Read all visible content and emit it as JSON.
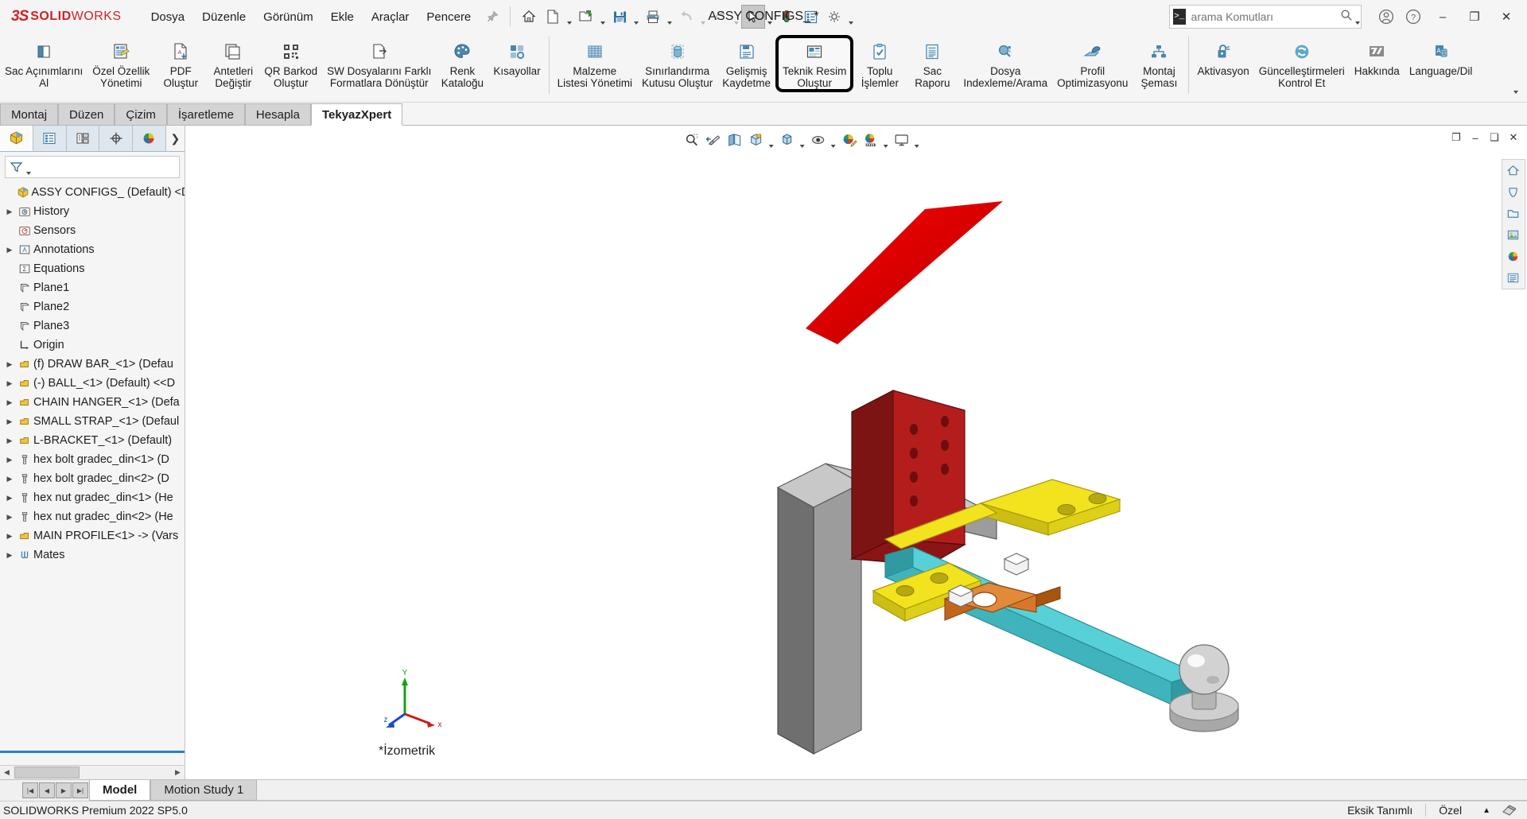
{
  "app": {
    "brand_ds": "3S",
    "brand_bold": "SOLID",
    "brand_light": "WORKS",
    "document_title": "ASSY CONFIGS_ *",
    "accent_red": "#d42027",
    "accent_blue": "#2b7fc4"
  },
  "menubar": {
    "items": [
      {
        "label": "Dosya"
      },
      {
        "label": "Düzenle"
      },
      {
        "label": "Görünüm"
      },
      {
        "label": "Ekle"
      },
      {
        "label": "Araçlar"
      },
      {
        "label": "Pencere"
      }
    ],
    "pin_icon": "pin-icon"
  },
  "quick_access": {
    "buttons": [
      {
        "name": "home-icon",
        "has_caret": false,
        "selected": false,
        "disabled": false
      },
      {
        "name": "new-document-icon",
        "has_caret": true,
        "selected": false,
        "disabled": false
      },
      {
        "name": "open-folder-icon",
        "has_caret": true,
        "selected": false,
        "disabled": false
      },
      {
        "name": "save-icon",
        "has_caret": true,
        "selected": false,
        "disabled": false
      },
      {
        "name": "print-icon",
        "has_caret": true,
        "selected": false,
        "disabled": false
      },
      {
        "name": "undo-icon",
        "has_caret": true,
        "selected": false,
        "disabled": true
      },
      {
        "name": "redo-icon",
        "has_caret": true,
        "selected": false,
        "disabled": true
      },
      {
        "name": "select-cursor-icon",
        "has_caret": true,
        "selected": true,
        "disabled": false
      },
      {
        "name": "rebuild-traffic-light-icon",
        "has_caret": false,
        "selected": false,
        "disabled": false
      },
      {
        "name": "file-properties-icon",
        "has_caret": false,
        "selected": false,
        "disabled": false
      },
      {
        "name": "options-gear-icon",
        "has_caret": true,
        "selected": false,
        "disabled": false
      }
    ]
  },
  "search": {
    "placeholder": "arama Komutları",
    "value": "",
    "prompt_glyph": ">_"
  },
  "window_controls": {
    "account": "account-icon",
    "help": "help-icon",
    "minimize": "–",
    "restore": "❐",
    "close": "✕"
  },
  "ribbon": {
    "groups": [
      {
        "name": "tekyazxpert-tools",
        "buttons": [
          {
            "label": "Sac Açınımlarını\nAl",
            "icon": "sheet-metal-flatten-icon",
            "highlight": false
          },
          {
            "label": "Özel Özellik\nYönetimi",
            "icon": "custom-property-icon",
            "highlight": false
          },
          {
            "label": "PDF\nOluştur",
            "icon": "pdf-create-icon",
            "highlight": false
          },
          {
            "label": "Antetleri\nDeğiştir",
            "icon": "title-block-change-icon",
            "highlight": false
          },
          {
            "label": "QR Barkod\nOluştur",
            "icon": "qr-barcode-icon",
            "highlight": false
          },
          {
            "label": "SW Dosyalarını Farklı\nFormatlara Dönüştür",
            "icon": "export-format-icon",
            "highlight": false
          },
          {
            "label": "Renk\nKataloğu",
            "icon": "color-palette-icon",
            "highlight": false
          },
          {
            "label": "Kısayollar",
            "icon": "shortcuts-icon",
            "highlight": false
          }
        ]
      },
      {
        "name": "management-tools",
        "buttons": [
          {
            "label": "Malzeme\nListesi Yönetimi",
            "icon": "bom-table-icon",
            "highlight": false
          },
          {
            "label": "Sınırlandırma\nKutusu Oluştur",
            "icon": "bounding-box-icon",
            "highlight": false
          },
          {
            "label": "Gelişmiş\nKaydetme",
            "icon": "advanced-save-icon",
            "highlight": false
          },
          {
            "label": "Teknik Resim\nOluştur",
            "icon": "create-drawing-icon",
            "highlight": true
          },
          {
            "label": "Toplu\nİşlemler",
            "icon": "batch-operations-icon",
            "highlight": false
          },
          {
            "label": "Sac\nRaporu",
            "icon": "sheet-metal-report-icon",
            "highlight": false
          },
          {
            "label": "Dosya\nIndexleme/Arama",
            "icon": "file-index-search-icon",
            "highlight": false
          },
          {
            "label": "Profil\nOptimizasyonu",
            "icon": "profile-optimization-icon",
            "highlight": false
          },
          {
            "label": "Montaj\nŞeması",
            "icon": "assembly-schema-icon",
            "highlight": false
          }
        ]
      },
      {
        "name": "about-tools",
        "buttons": [
          {
            "label": "Aktivasyon",
            "icon": "activation-lock-icon",
            "highlight": false
          },
          {
            "label": "Güncelleştirmeleri\nKontrol Et",
            "icon": "check-updates-icon",
            "highlight": false
          },
          {
            "label": "Hakkında",
            "icon": "about-logo-icon",
            "highlight": false
          },
          {
            "label": "Language/Dil",
            "icon": "language-icon",
            "highlight": false
          }
        ]
      }
    ],
    "collapse_icon": "chevron-down-icon"
  },
  "command_tabs": [
    {
      "label": "Montaj",
      "active": false
    },
    {
      "label": "Düzen",
      "active": false
    },
    {
      "label": "Çizim",
      "active": false
    },
    {
      "label": "İşaretleme",
      "active": false
    },
    {
      "label": "Hesapla",
      "active": false
    },
    {
      "label": "TekyazXpert",
      "active": true
    }
  ],
  "tree_panel": {
    "tabs": [
      {
        "name": "feature-manager-tab",
        "icon": "assembly-tree-icon",
        "active": true
      },
      {
        "name": "property-manager-tab",
        "icon": "property-list-icon",
        "active": false
      },
      {
        "name": "configuration-manager-tab",
        "icon": "configuration-icon",
        "active": false
      },
      {
        "name": "dimxpert-manager-tab",
        "icon": "dimxpert-icon",
        "active": false
      },
      {
        "name": "display-manager-tab",
        "icon": "display-sphere-icon",
        "active": false
      },
      {
        "name": "more-tabs",
        "icon": "chevron-right-icon",
        "active": false
      }
    ],
    "filter_placeholder": "",
    "filter_icon": "filter-funnel-icon",
    "items": [
      {
        "label": "ASSY CONFIGS_ (Default) <De",
        "icon": "assembly-icon",
        "indent": 0,
        "expandable": false,
        "root": true
      },
      {
        "label": "History",
        "icon": "history-icon",
        "indent": 1,
        "expandable": true
      },
      {
        "label": "Sensors",
        "icon": "sensors-icon",
        "indent": 1,
        "expandable": false
      },
      {
        "label": "Annotations",
        "icon": "annotations-icon",
        "indent": 1,
        "expandable": true
      },
      {
        "label": "Equations",
        "icon": "equations-icon",
        "indent": 1,
        "expandable": false
      },
      {
        "label": "Plane1",
        "icon": "plane-icon",
        "indent": 1,
        "expandable": false
      },
      {
        "label": "Plane2",
        "icon": "plane-icon",
        "indent": 1,
        "expandable": false
      },
      {
        "label": "Plane3",
        "icon": "plane-icon",
        "indent": 1,
        "expandable": false
      },
      {
        "label": "Origin",
        "icon": "origin-icon",
        "indent": 1,
        "expandable": false
      },
      {
        "label": "(f) DRAW BAR_<1> (Defau",
        "icon": "part-icon",
        "indent": 1,
        "expandable": true
      },
      {
        "label": "(-) BALL_<1> (Default) <<D",
        "icon": "part-icon",
        "indent": 1,
        "expandable": true
      },
      {
        "label": "CHAIN HANGER_<1> (Defa",
        "icon": "part-icon",
        "indent": 1,
        "expandable": true
      },
      {
        "label": "SMALL STRAP_<1> (Defaul",
        "icon": "part-icon",
        "indent": 1,
        "expandable": true
      },
      {
        "label": "L-BRACKET_<1> (Default)",
        "icon": "part-icon",
        "indent": 1,
        "expandable": true
      },
      {
        "label": "hex bolt gradec_din<1> (D",
        "icon": "bolt-icon",
        "indent": 1,
        "expandable": true
      },
      {
        "label": "hex bolt gradec_din<2> (D",
        "icon": "bolt-icon",
        "indent": 1,
        "expandable": true
      },
      {
        "label": "hex nut gradec_din<1> (He",
        "icon": "bolt-icon",
        "indent": 1,
        "expandable": true
      },
      {
        "label": "hex nut gradec_din<2> (He",
        "icon": "bolt-icon",
        "indent": 1,
        "expandable": true
      },
      {
        "label": "MAIN PROFILE<1> -> (Vars",
        "icon": "part-icon",
        "indent": 1,
        "expandable": true
      },
      {
        "label": "Mates",
        "icon": "mates-icon",
        "indent": 1,
        "expandable": true
      }
    ]
  },
  "view_toolbar": {
    "buttons": [
      {
        "name": "zoom-to-area-icon",
        "has_caret": false
      },
      {
        "name": "previous-view-icon",
        "has_caret": false
      },
      {
        "name": "section-view-icon",
        "has_caret": false
      },
      {
        "name": "view-orientation-icon",
        "has_caret": true
      },
      {
        "name": "display-style-icon",
        "has_caret": true
      },
      {
        "name": "hide-show-items-icon",
        "has_caret": true
      },
      {
        "name": "edit-appearance-icon",
        "has_caret": false
      },
      {
        "name": "apply-scene-icon",
        "has_caret": true
      },
      {
        "name": "view-settings-icon",
        "has_caret": true
      }
    ]
  },
  "graphics": {
    "view_label": "*İzometrik",
    "triad_axes": {
      "x": "x",
      "y": "Y",
      "z": "z"
    },
    "doc_window_controls": [
      {
        "name": "restore-doc-icon",
        "glyph": "❐"
      },
      {
        "name": "minimize-doc-icon",
        "glyph": "–"
      },
      {
        "name": "maximize-doc-icon",
        "glyph": "❏"
      },
      {
        "name": "close-doc-icon",
        "glyph": "✕"
      }
    ],
    "right_dock": [
      {
        "name": "view-home-icon"
      },
      {
        "name": "view-rotate-icon"
      },
      {
        "name": "view-open-icon"
      },
      {
        "name": "view-appearances-icon"
      },
      {
        "name": "view-scenes-icon"
      },
      {
        "name": "view-custom-icon"
      }
    ]
  },
  "bottom_tabs": {
    "nav_buttons": [
      "|◀",
      "◀",
      "▶",
      "▶|"
    ],
    "tabs": [
      {
        "label": "Model",
        "active": true
      },
      {
        "label": "Motion Study 1",
        "active": false
      }
    ]
  },
  "statusbar": {
    "left": "SOLIDWORKS Premium 2022 SP5.0",
    "state": "Eksik Tanımlı",
    "units": "Özel",
    "units_caret": "▲",
    "editing_icon": "edit-mode-icon"
  }
}
